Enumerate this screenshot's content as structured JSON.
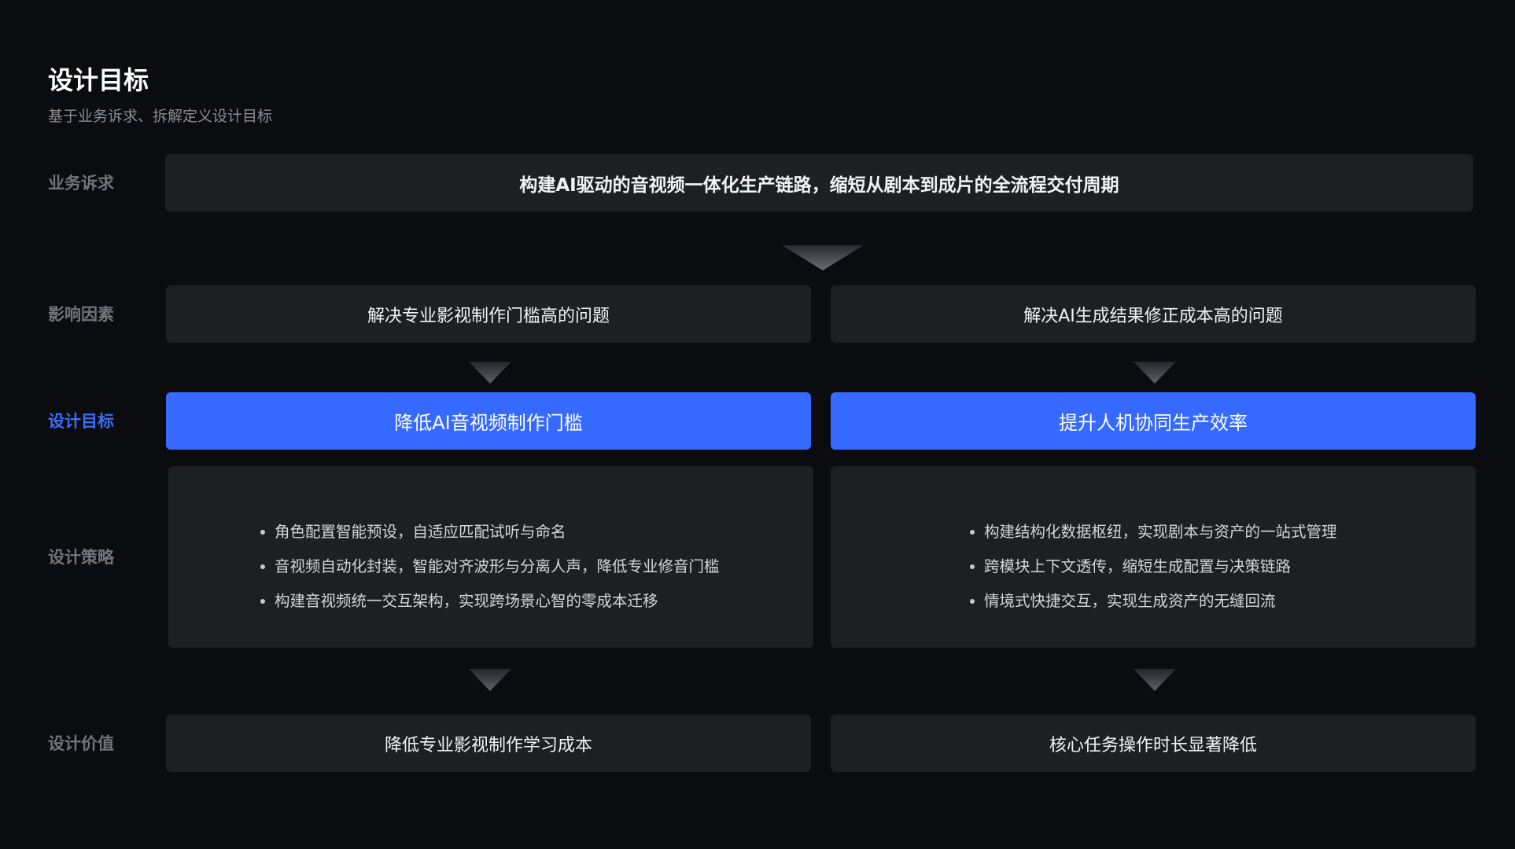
{
  "header": {
    "title": "设计目标",
    "subtitle": "基于业务诉求、拆解定义设计目标"
  },
  "rows": {
    "business": {
      "label": "业务诉求",
      "content": "构建AI驱动的音视频一体化生产链路，缩短从剧本到成片的全流程交付周期"
    },
    "factors": {
      "label": "影响因素",
      "left": "解决专业影视制作门槛高的问题",
      "right": "解决AI生成结果修正成本高的问题"
    },
    "goals": {
      "label": "设计目标",
      "left": "降低AI音视频制作门槛",
      "right": "提升人机协同生产效率"
    },
    "strategy": {
      "label": "设计策略",
      "left": [
        "角色配置智能预设，自适应匹配试听与命名",
        "音视频自动化封装，智能对齐波形与分离人声，降低专业修音门槛",
        "构建音视频统一交互架构，实现跨场景心智的零成本迁移"
      ],
      "right": [
        "构建结构化数据枢纽，实现剧本与资产的一站式管理",
        "跨模块上下文透传，缩短生成配置与决策链路",
        "情境式快捷交互，实现生成资产的无缝回流"
      ]
    },
    "value": {
      "label": "设计价值",
      "left": "降低专业影视制作学习成本",
      "right": "核心任务操作时长显著降低"
    }
  },
  "colors": {
    "background": "#0b0c0f",
    "card": "#1e1f22",
    "accent": "#3669ff",
    "label": "#71747b",
    "active_label": "#3b6ef8"
  }
}
